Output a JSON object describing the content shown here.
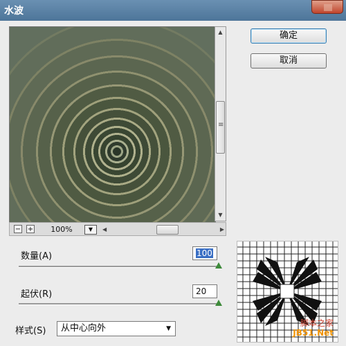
{
  "window": {
    "title": "水波"
  },
  "buttons": {
    "ok": "确定",
    "cancel": "取消"
  },
  "zoom": {
    "minus": "−",
    "plus": "+",
    "value": "100%"
  },
  "params": {
    "amount_label": "数量(A)",
    "amount_value": "100",
    "ridges_label": "起伏(R)",
    "ridges_value": "20",
    "style_label": "样式(S)",
    "style_value": "从中心向外"
  },
  "watermark": {
    "line1": "脚本之家",
    "line2": "JB51.Net"
  },
  "colors": {
    "title_bar": "#5d83a8",
    "ok_border": "#3c7fb1",
    "slider_knob": "#3d8a3a"
  }
}
